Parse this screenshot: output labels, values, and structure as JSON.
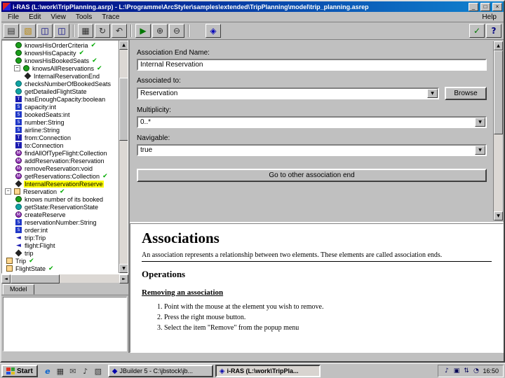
{
  "window": {
    "title": "i-RAS (L:\\work\\TripPlanning.asrp) - L:\\Programme\\ArcStyler\\samples\\extended\\TripPlanning\\model\\trip_planning.asrep",
    "controls": {
      "minimize": "_",
      "maximize": "□",
      "close": "×"
    }
  },
  "menubar": {
    "items": [
      "File",
      "Edit",
      "View",
      "Tools",
      "Trace"
    ],
    "help": "Help"
  },
  "toolbar": {
    "groups": [
      [
        "new-icon",
        "open-icon",
        "save-icon",
        "saveall-icon"
      ],
      [
        "print-icon",
        "refresh-icon",
        "undo-icon"
      ],
      [
        "run-icon",
        "zoomin-icon",
        "zoomout-icon"
      ]
    ],
    "standalone": "model-icon",
    "right": [
      "verify-icon",
      "help-icon"
    ]
  },
  "left": {
    "tab_label": "Model"
  },
  "tree": {
    "items": [
      {
        "label": "knowsHisOrderCriteria",
        "icon": "green",
        "indent": 1,
        "check": true
      },
      {
        "label": "knowsHisCapacity",
        "icon": "green",
        "indent": 1,
        "check": true
      },
      {
        "label": "knowsHisBookedSeats",
        "icon": "green",
        "indent": 1,
        "check": true
      },
      {
        "label": "knowsAllReservations",
        "icon": "green",
        "indent": 1,
        "check": true,
        "expander": true
      },
      {
        "label": "InternalReservationEnd",
        "icon": "diamond",
        "indent": 2
      },
      {
        "label": "checksNumberOfBookedSeats",
        "icon": "teal",
        "indent": 1
      },
      {
        "label": "getDetailedFlightState",
        "icon": "teal",
        "indent": 1
      },
      {
        "label": "hasEnoughCapacity:boolean",
        "icon": "t",
        "indent": 1
      },
      {
        "label": "capacity:int",
        "icon": "st",
        "indent": 1
      },
      {
        "label": "bookedSeats:int",
        "icon": "st",
        "indent": 1
      },
      {
        "label": "number:String",
        "icon": "st",
        "indent": 1
      },
      {
        "label": "airline:String",
        "icon": "st",
        "indent": 1
      },
      {
        "label": "from:Connection",
        "icon": "t",
        "indent": 1
      },
      {
        "label": "to:Connection",
        "icon": "t",
        "indent": 1
      },
      {
        "label": "findAllOfTypeFlight:Collection",
        "icon": "m",
        "indent": 1
      },
      {
        "label": "addReservation:Reservation",
        "icon": "m",
        "indent": 1
      },
      {
        "label": "removeReservation:void",
        "icon": "m",
        "indent": 1
      },
      {
        "label": "getReservations:Collection",
        "icon": "m",
        "indent": 1,
        "check": true
      },
      {
        "label": "InternalReservationReserve",
        "icon": "diamond",
        "indent": 1,
        "selected": true
      },
      {
        "label": "Reservation",
        "icon": "class",
        "indent": 0,
        "check": true,
        "expander": true
      },
      {
        "label": "knows number of its booked",
        "icon": "green",
        "indent": 1
      },
      {
        "label": "getState:ReservationState",
        "icon": "teal",
        "indent": 1
      },
      {
        "label": "createReserve",
        "icon": "m",
        "indent": 1
      },
      {
        "label": "reservationNumber:String",
        "icon": "st",
        "indent": 1
      },
      {
        "label": "order:int",
        "icon": "st",
        "indent": 1
      },
      {
        "label": "trip:Trip",
        "icon": "arrow",
        "indent": 1
      },
      {
        "label": "flight:Flight",
        "icon": "arrow",
        "indent": 1
      },
      {
        "label": "trip",
        "icon": "diamond",
        "indent": 1
      },
      {
        "label": "Trip",
        "icon": "class",
        "indent": 0,
        "check": true
      },
      {
        "label": "FlightState",
        "icon": "class",
        "indent": 0,
        "check": true
      }
    ]
  },
  "form": {
    "assoc_end_name": {
      "label": "Association End Name:",
      "value": "Internal Reservation"
    },
    "associated_to": {
      "label": "Associated to:",
      "value": "Reservation",
      "browse_label": "Browse"
    },
    "multiplicity": {
      "label": "Multiplicity:",
      "value": "0..*"
    },
    "navigable": {
      "label": "Navigable:",
      "value": "true"
    },
    "go_button_label": "Go to other association end"
  },
  "docs": {
    "title": "Associations",
    "intro": "An association represents a relationship between two elements. These elements are called association ends.",
    "operations_title": "Operations",
    "removing_title": "Removing an association",
    "steps": [
      "Point with the mouse at the element you wish to remove.",
      "Press the right mouse button.",
      "Select the item \"Remove\" from the popup menu"
    ]
  },
  "taskbar": {
    "start_label": "Start",
    "quick_launch": [
      "ie-icon",
      "desktop-icon",
      "mail-icon",
      "media-icon",
      "explorer-icon"
    ],
    "tasks": [
      {
        "label": "JBuilder 5 - C:\\jbstock\\jb...",
        "icon": "jbuilder-icon",
        "active": false
      },
      {
        "label": "i-RAS (L:\\work\\TripPla...",
        "icon": "iras-icon",
        "active": true
      }
    ],
    "tray": {
      "icons": [
        "volume-icon",
        "display-icon",
        "network-icon",
        "scheduler-icon"
      ],
      "time": "16:50"
    }
  }
}
